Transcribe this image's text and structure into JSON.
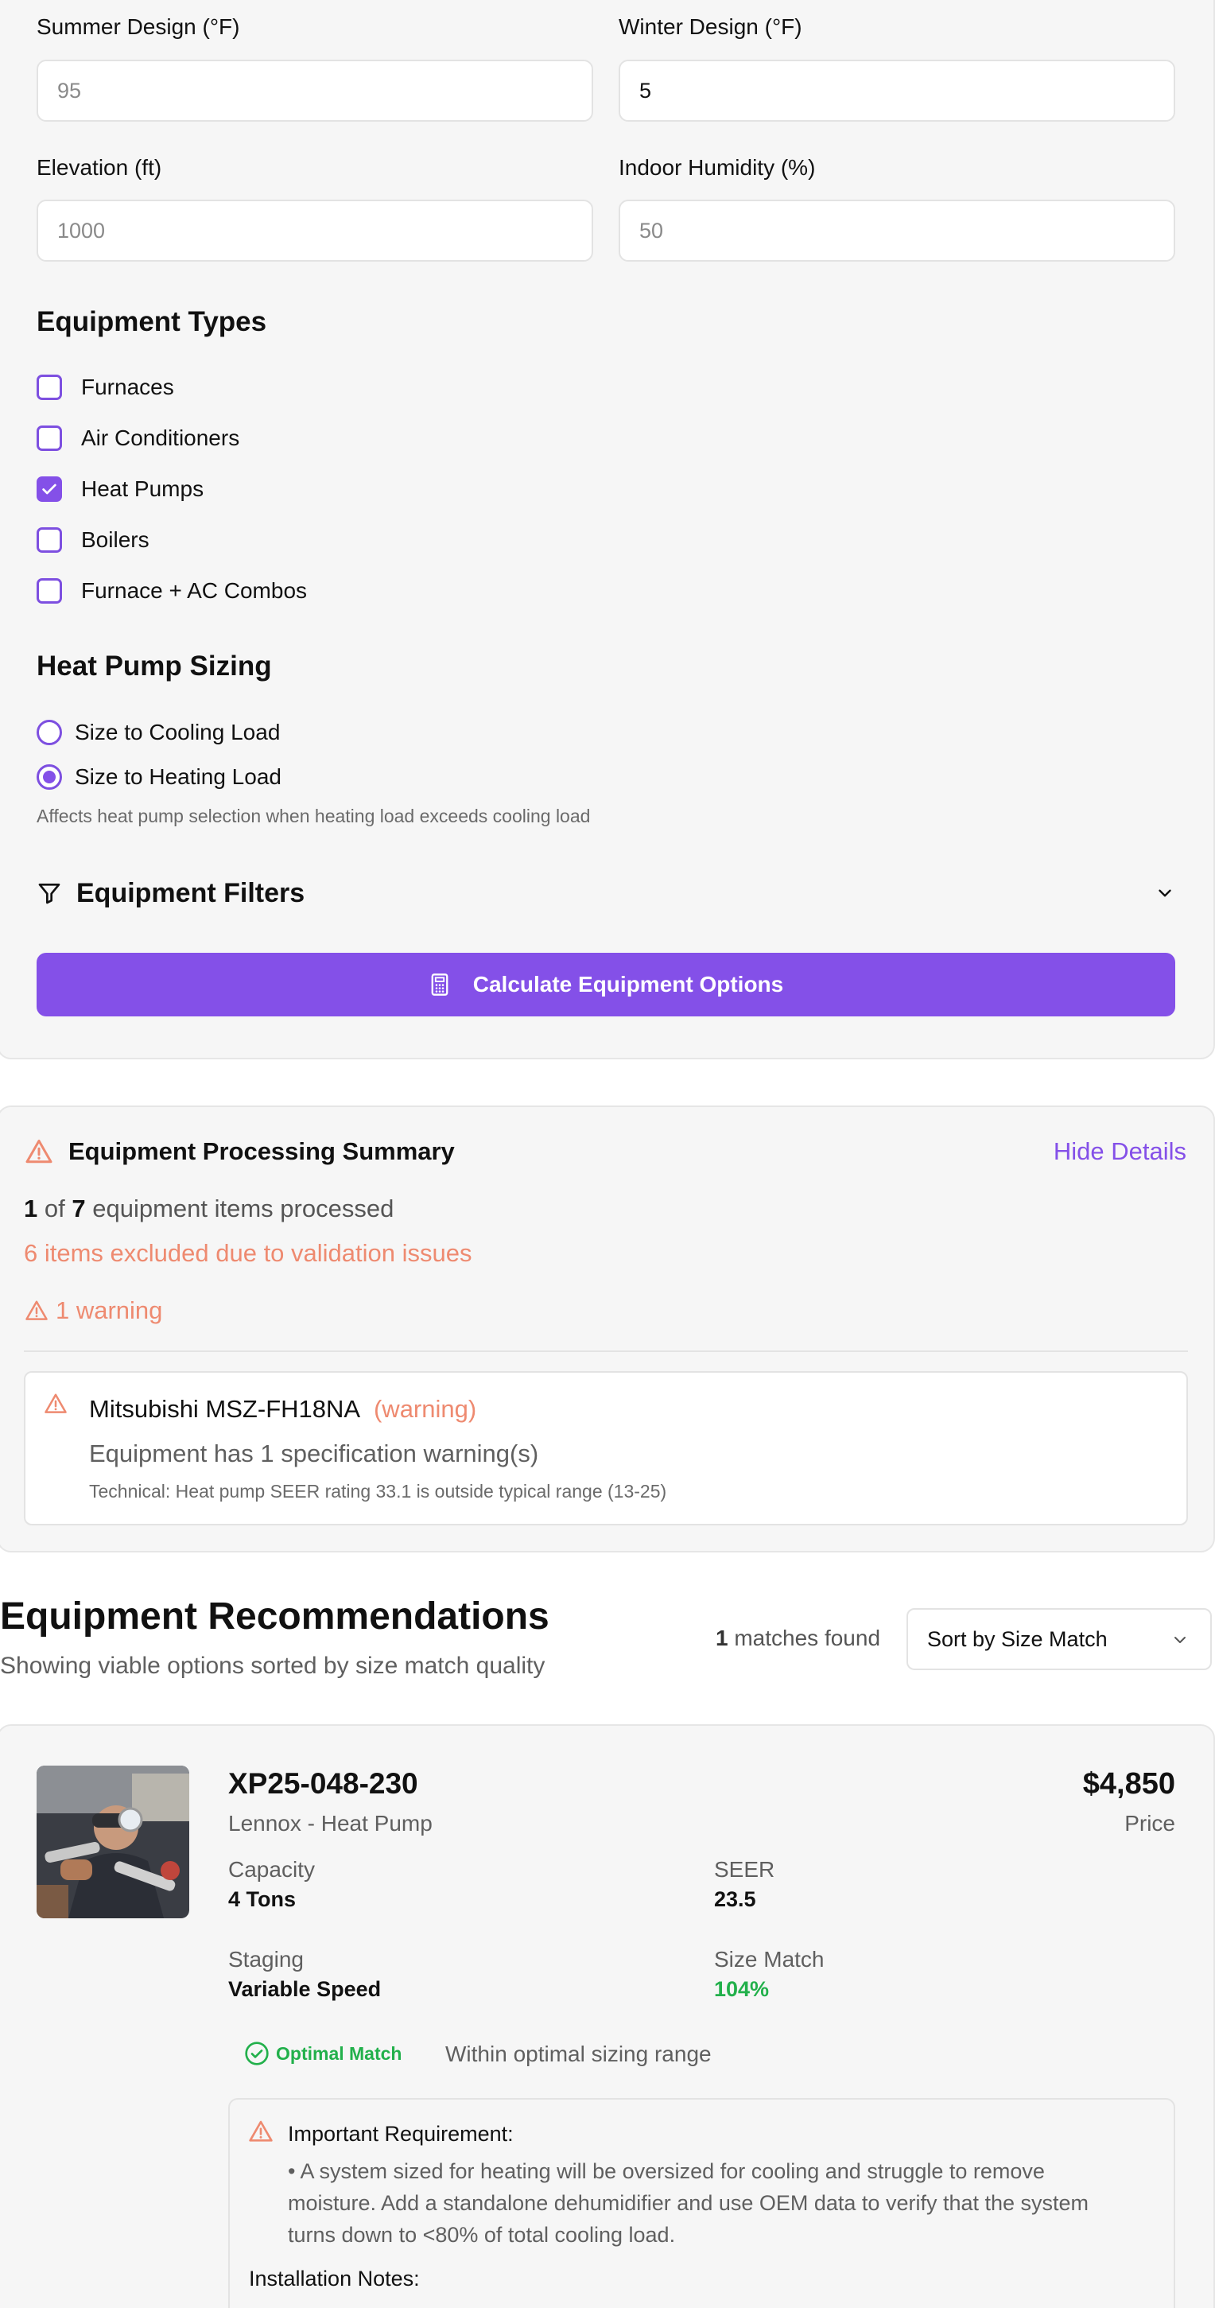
{
  "form": {
    "summer_label": "Summer Design (°F)",
    "summer_placeholder": "95",
    "winter_label": "Winter Design (°F)",
    "winter_value": "5",
    "elevation_label": "Elevation (ft)",
    "elevation_placeholder": "1000",
    "humidity_label": "Indoor Humidity (%)",
    "humidity_placeholder": "50"
  },
  "equipment_types": {
    "title": "Equipment Types",
    "items": [
      {
        "label": "Furnaces",
        "checked": false
      },
      {
        "label": "Air Conditioners",
        "checked": false
      },
      {
        "label": "Heat Pumps",
        "checked": true
      },
      {
        "label": "Boilers",
        "checked": false
      },
      {
        "label": "Furnace + AC Combos",
        "checked": false
      }
    ]
  },
  "heat_pump_sizing": {
    "title": "Heat Pump Sizing",
    "options": [
      {
        "label": "Size to Cooling Load",
        "selected": false
      },
      {
        "label": "Size to Heating Load",
        "selected": true
      }
    ],
    "hint": "Affects heat pump selection when heating load exceeds cooling load"
  },
  "filters": {
    "title": "Equipment Filters",
    "icon": "filter-icon"
  },
  "calculate_button": {
    "label": "Calculate Equipment Options",
    "icon": "calculator-icon"
  },
  "summary": {
    "title": "Equipment Processing Summary",
    "toggle_label": "Hide Details",
    "processed_count": "1",
    "processed_of": "of",
    "total_count": "7",
    "processed_suffix": "equipment items processed",
    "excluded_text": "6 items excluded due to validation issues",
    "warning_count_text": "1 warning",
    "warning_item": {
      "name": "Mitsubishi MSZ-FH18NA",
      "tag": "(warning)",
      "message": "Equipment has 1 specification warning(s)",
      "detail": "Technical: Heat pump SEER rating 33.1 is outside typical range (13-25)"
    }
  },
  "recommendations": {
    "title": "Equipment Recommendations",
    "subtitle": "Showing viable options sorted by size match quality",
    "matches_count": "1",
    "matches_label": "matches found",
    "sort_value": "Sort by Size Match"
  },
  "product": {
    "model": "XP25-048-230",
    "brand_type": "Lennox - Heat Pump",
    "price": "$4,850",
    "price_label": "Price",
    "capacity_label": "Capacity",
    "capacity_value": "4 Tons",
    "seer_label": "SEER",
    "seer_value": "23.5",
    "staging_label": "Staging",
    "staging_value": "Variable Speed",
    "size_match_label": "Size Match",
    "size_match_value": "104%",
    "badge_label": "Optimal Match",
    "badge_desc": "Within optimal sizing range",
    "requirement_title": "Important Requirement:",
    "requirement_text": "• A system sized for heating will be oversized for cooling and struggle to remove moisture. Add a standalone dehumidifier and use OEM data to verify that the system turns down to <80% of total cooling load.",
    "installation_title": "Installation Notes:"
  },
  "colors": {
    "accent": "#8450e8",
    "warning": "#ee8a70",
    "success": "#22b04b",
    "panel_bg": "#f6f6f6"
  }
}
